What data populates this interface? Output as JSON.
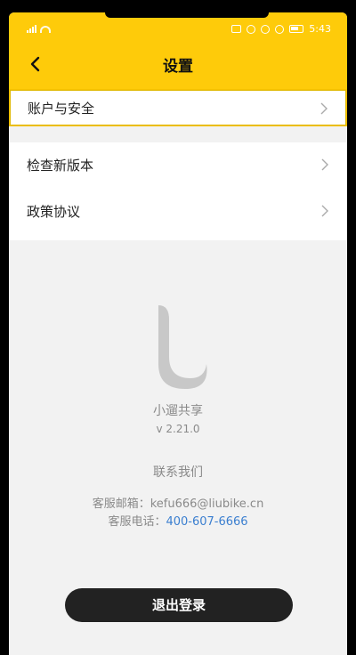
{
  "status_bar": {
    "time": "5:43"
  },
  "header": {
    "title": "设置"
  },
  "menu": [
    {
      "label": "账户与安全"
    },
    {
      "label": "检查新版本"
    },
    {
      "label": "政策协议"
    }
  ],
  "about": {
    "app_name": "小遛共享",
    "version": "v 2.21.0",
    "contact_title": "联系我们",
    "email_label": "客服邮箱：",
    "email_value": "kefu666@liubike.cn",
    "phone_label": "客服电话：",
    "phone_value": "400-607-6666"
  },
  "logout_label": "退出登录",
  "colors": {
    "header": "#fecb0a",
    "link": "#3b7fd0",
    "button": "#222222"
  }
}
